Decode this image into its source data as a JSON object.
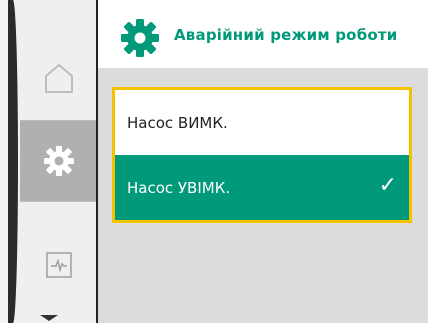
{
  "header": {
    "title": "Аварійний режим роботи",
    "icon": "gear-icon",
    "accent": "#00997a"
  },
  "sidebar": {
    "items": [
      {
        "name": "home-icon",
        "active": false
      },
      {
        "name": "gear-icon",
        "active": true
      },
      {
        "name": "diagnostics-icon",
        "active": false
      }
    ],
    "down_arrow": "chevron-down-icon"
  },
  "menu": {
    "highlight_color": "#f3c300",
    "options": [
      {
        "label": "Насос ВИМК.",
        "selected": false
      },
      {
        "label": "Насос УВІМК.",
        "selected": true
      }
    ],
    "check_mark": "✓"
  }
}
